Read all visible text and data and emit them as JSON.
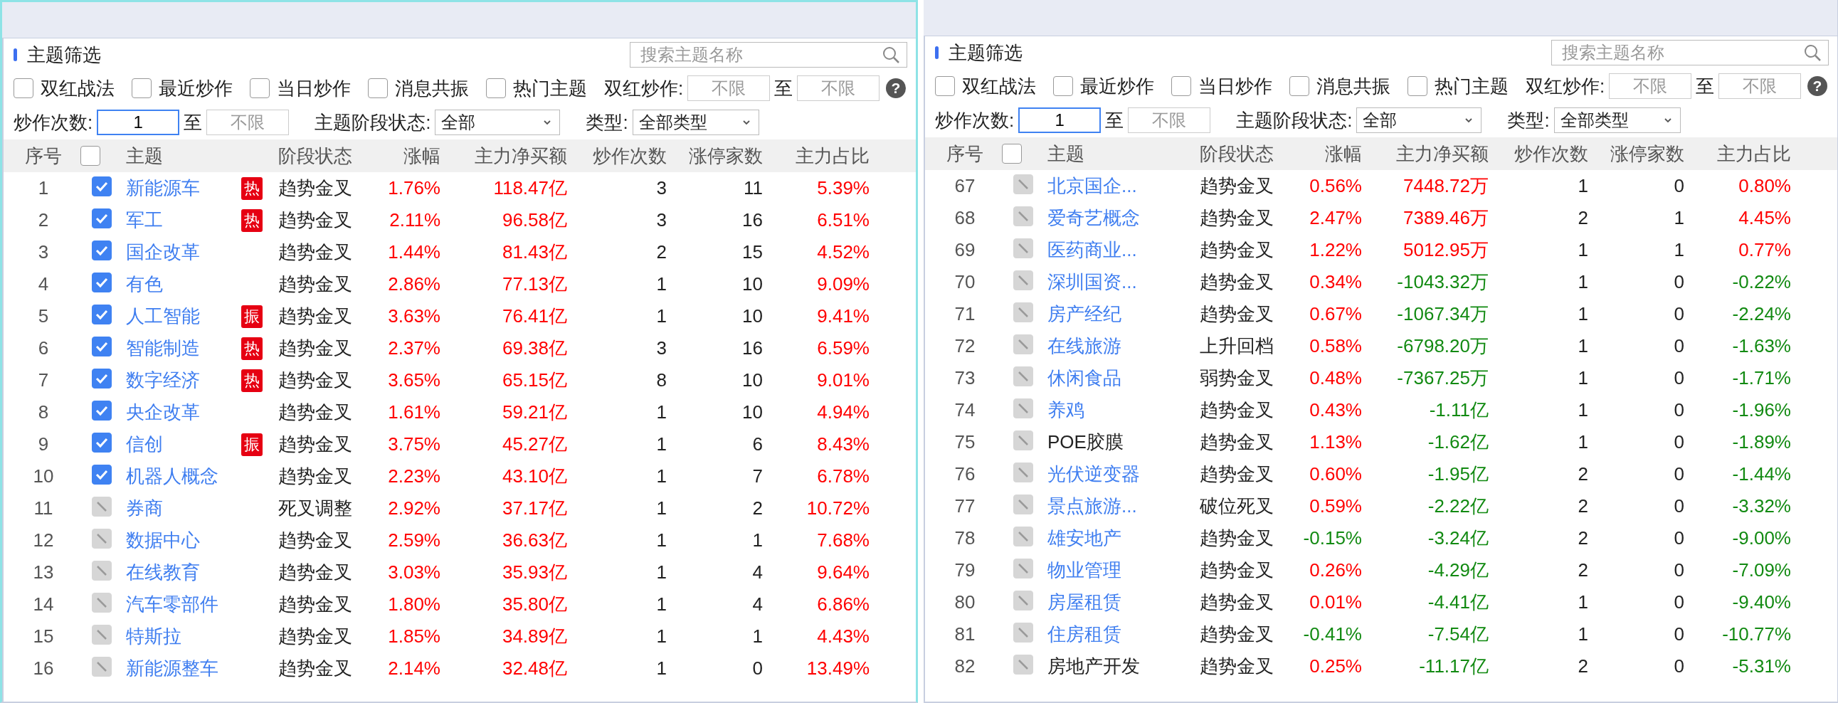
{
  "panels": [
    {
      "active": true,
      "title": "主题筛选",
      "search": {
        "placeholder": "搜索主题名称"
      },
      "filters": [
        {
          "label": "双红战法",
          "checked": false
        },
        {
          "label": "最近炒作",
          "checked": false
        },
        {
          "label": "当日炒作",
          "checked": false
        },
        {
          "label": "消息共振",
          "checked": false
        },
        {
          "label": "热门主题",
          "checked": false
        }
      ],
      "double_red": {
        "label": "双红炒作:",
        "from": {
          "placeholder": "不限"
        },
        "to_label": "至",
        "to": {
          "placeholder": "不限"
        }
      },
      "help_icon": "?",
      "hype_count": {
        "label": "炒作次数:",
        "from": {
          "value": "1",
          "focused": true
        },
        "to_label": "至",
        "to": {
          "placeholder": "不限"
        }
      },
      "stage": {
        "label": "主题阶段状态:",
        "value": "全部"
      },
      "type": {
        "label": "类型:",
        "value": "全部类型"
      },
      "columns": [
        "序号",
        "主题",
        "阶段状态",
        "涨幅",
        "主力净买额",
        "炒作次数",
        "涨停家数",
        "主力占比"
      ],
      "header_checked": false,
      "rows": [
        {
          "index": "1",
          "checked": true,
          "theme": "新能源车",
          "link": true,
          "badge": "热",
          "stage": "趋势金叉",
          "change": "1.76%",
          "net": "118.47亿",
          "count": "3",
          "limit_up": "11",
          "ratio": "5.39%",
          "up": [
            true,
            true,
            true
          ]
        },
        {
          "index": "2",
          "checked": true,
          "theme": "军工",
          "link": true,
          "badge": "热",
          "stage": "趋势金叉",
          "change": "2.11%",
          "net": "96.58亿",
          "count": "3",
          "limit_up": "16",
          "ratio": "6.51%",
          "up": [
            true,
            true,
            true
          ]
        },
        {
          "index": "3",
          "checked": true,
          "theme": "国企改革",
          "link": true,
          "stage": "趋势金叉",
          "change": "1.44%",
          "net": "81.43亿",
          "count": "2",
          "limit_up": "15",
          "ratio": "4.52%",
          "up": [
            true,
            true,
            true
          ]
        },
        {
          "index": "4",
          "checked": true,
          "theme": "有色",
          "link": true,
          "stage": "趋势金叉",
          "change": "2.86%",
          "net": "77.13亿",
          "count": "1",
          "limit_up": "10",
          "ratio": "9.09%",
          "up": [
            true,
            true,
            true
          ]
        },
        {
          "index": "5",
          "checked": true,
          "theme": "人工智能",
          "link": true,
          "badge": "振",
          "stage": "趋势金叉",
          "change": "3.63%",
          "net": "76.41亿",
          "count": "1",
          "limit_up": "10",
          "ratio": "9.41%",
          "up": [
            true,
            true,
            true
          ]
        },
        {
          "index": "6",
          "checked": true,
          "theme": "智能制造",
          "link": true,
          "badge": "热",
          "stage": "趋势金叉",
          "change": "2.37%",
          "net": "69.38亿",
          "count": "3",
          "limit_up": "16",
          "ratio": "6.59%",
          "up": [
            true,
            true,
            true
          ]
        },
        {
          "index": "7",
          "checked": true,
          "theme": "数字经济",
          "link": true,
          "badge": "热",
          "stage": "趋势金叉",
          "change": "3.65%",
          "net": "65.15亿",
          "count": "8",
          "limit_up": "10",
          "ratio": "9.01%",
          "up": [
            true,
            true,
            true
          ]
        },
        {
          "index": "8",
          "checked": true,
          "theme": "央企改革",
          "link": true,
          "stage": "趋势金叉",
          "change": "1.61%",
          "net": "59.21亿",
          "count": "1",
          "limit_up": "10",
          "ratio": "4.94%",
          "up": [
            true,
            true,
            true
          ]
        },
        {
          "index": "9",
          "checked": true,
          "theme": "信创",
          "link": true,
          "badge": "振",
          "stage": "趋势金叉",
          "change": "3.75%",
          "net": "45.27亿",
          "count": "1",
          "limit_up": "6",
          "ratio": "8.43%",
          "up": [
            true,
            true,
            true
          ]
        },
        {
          "index": "10",
          "checked": true,
          "theme": "机器人概念",
          "link": true,
          "stage": "趋势金叉",
          "change": "2.23%",
          "net": "43.10亿",
          "count": "1",
          "limit_up": "7",
          "ratio": "6.78%",
          "up": [
            true,
            true,
            true
          ]
        },
        {
          "index": "11",
          "checked": false,
          "theme": "券商",
          "link": true,
          "stage": "死叉调整",
          "change": "2.92%",
          "net": "37.17亿",
          "count": "1",
          "limit_up": "2",
          "ratio": "10.72%",
          "up": [
            true,
            true,
            true
          ]
        },
        {
          "index": "12",
          "checked": false,
          "theme": "数据中心",
          "link": true,
          "stage": "趋势金叉",
          "change": "2.59%",
          "net": "36.63亿",
          "count": "1",
          "limit_up": "1",
          "ratio": "7.68%",
          "up": [
            true,
            true,
            true
          ]
        },
        {
          "index": "13",
          "checked": false,
          "theme": "在线教育",
          "link": true,
          "stage": "趋势金叉",
          "change": "3.03%",
          "net": "35.93亿",
          "count": "1",
          "limit_up": "4",
          "ratio": "9.64%",
          "up": [
            true,
            true,
            true
          ]
        },
        {
          "index": "14",
          "checked": false,
          "theme": "汽车零部件",
          "link": true,
          "stage": "趋势金叉",
          "change": "1.80%",
          "net": "35.80亿",
          "count": "1",
          "limit_up": "4",
          "ratio": "6.86%",
          "up": [
            true,
            true,
            true
          ]
        },
        {
          "index": "15",
          "checked": false,
          "theme": "特斯拉",
          "link": true,
          "stage": "趋势金叉",
          "change": "1.85%",
          "net": "34.89亿",
          "count": "1",
          "limit_up": "1",
          "ratio": "4.43%",
          "up": [
            true,
            true,
            true
          ]
        },
        {
          "index": "16",
          "checked": false,
          "theme": "新能源整车",
          "link": true,
          "stage": "趋势金叉",
          "change": "2.14%",
          "net": "32.48亿",
          "count": "1",
          "limit_up": "0",
          "ratio": "13.49%",
          "up": [
            true,
            true,
            true
          ]
        }
      ]
    },
    {
      "active": false,
      "title": "主题筛选",
      "search": {
        "placeholder": "搜索主题名称"
      },
      "filters": [
        {
          "label": "双红战法",
          "checked": false
        },
        {
          "label": "最近炒作",
          "checked": false
        },
        {
          "label": "当日炒作",
          "checked": false
        },
        {
          "label": "消息共振",
          "checked": false
        },
        {
          "label": "热门主题",
          "checked": false
        }
      ],
      "double_red": {
        "label": "双红炒作:",
        "from": {
          "placeholder": "不限"
        },
        "to_label": "至",
        "to": {
          "placeholder": "不限"
        }
      },
      "help_icon": "?",
      "hype_count": {
        "label": "炒作次数:",
        "from": {
          "value": "1",
          "focused": true
        },
        "to_label": "至",
        "to": {
          "placeholder": "不限"
        }
      },
      "stage": {
        "label": "主题阶段状态:",
        "value": "全部"
      },
      "type": {
        "label": "类型:",
        "value": "全部类型"
      },
      "columns": [
        "序号",
        "主题",
        "阶段状态",
        "涨幅",
        "主力净买额",
        "炒作次数",
        "涨停家数",
        "主力占比"
      ],
      "header_checked": false,
      "rows": [
        {
          "index": "67",
          "checked": false,
          "theme": "北京国企...",
          "link": true,
          "stage": "趋势金叉",
          "change": "0.56%",
          "net": "7448.72万",
          "count": "1",
          "limit_up": "0",
          "ratio": "0.80%",
          "up": [
            true,
            true,
            true
          ]
        },
        {
          "index": "68",
          "checked": false,
          "theme": "爱奇艺概念",
          "link": true,
          "stage": "趋势金叉",
          "change": "2.47%",
          "net": "7389.46万",
          "count": "2",
          "limit_up": "1",
          "ratio": "4.45%",
          "up": [
            true,
            true,
            true
          ]
        },
        {
          "index": "69",
          "checked": false,
          "theme": "医药商业...",
          "link": true,
          "stage": "趋势金叉",
          "change": "1.22%",
          "net": "5012.95万",
          "count": "1",
          "limit_up": "1",
          "ratio": "0.77%",
          "up": [
            true,
            true,
            true
          ]
        },
        {
          "index": "70",
          "checked": false,
          "theme": "深圳国资...",
          "link": true,
          "stage": "趋势金叉",
          "change": "0.34%",
          "net": "-1043.32万",
          "count": "1",
          "limit_up": "0",
          "ratio": "-0.22%",
          "up": [
            true,
            false,
            false
          ]
        },
        {
          "index": "71",
          "checked": false,
          "theme": "房产经纪",
          "link": true,
          "stage": "趋势金叉",
          "change": "0.67%",
          "net": "-1067.34万",
          "count": "1",
          "limit_up": "0",
          "ratio": "-2.24%",
          "up": [
            true,
            false,
            false
          ]
        },
        {
          "index": "72",
          "checked": false,
          "theme": "在线旅游",
          "link": true,
          "stage": "上升回档",
          "change": "0.58%",
          "net": "-6798.20万",
          "count": "1",
          "limit_up": "0",
          "ratio": "-1.63%",
          "up": [
            true,
            false,
            false
          ]
        },
        {
          "index": "73",
          "checked": false,
          "theme": "休闲食品",
          "link": true,
          "stage": "弱势金叉",
          "change": "0.48%",
          "net": "-7367.25万",
          "count": "1",
          "limit_up": "0",
          "ratio": "-1.71%",
          "up": [
            true,
            false,
            false
          ]
        },
        {
          "index": "74",
          "checked": false,
          "theme": "养鸡",
          "link": true,
          "stage": "趋势金叉",
          "change": "0.43%",
          "net": "-1.11亿",
          "count": "1",
          "limit_up": "0",
          "ratio": "-1.96%",
          "up": [
            true,
            false,
            false
          ]
        },
        {
          "index": "75",
          "checked": false,
          "theme": "POE胶膜",
          "link": false,
          "stage": "趋势金叉",
          "change": "1.13%",
          "net": "-1.62亿",
          "count": "1",
          "limit_up": "0",
          "ratio": "-1.89%",
          "up": [
            true,
            false,
            false
          ]
        },
        {
          "index": "76",
          "checked": false,
          "theme": "光伏逆变器",
          "link": true,
          "stage": "趋势金叉",
          "change": "0.60%",
          "net": "-1.95亿",
          "count": "2",
          "limit_up": "0",
          "ratio": "-1.44%",
          "up": [
            true,
            false,
            false
          ]
        },
        {
          "index": "77",
          "checked": false,
          "theme": "景点旅游...",
          "link": true,
          "stage": "破位死叉",
          "change": "0.59%",
          "net": "-2.22亿",
          "count": "2",
          "limit_up": "0",
          "ratio": "-3.32%",
          "up": [
            true,
            false,
            false
          ]
        },
        {
          "index": "78",
          "checked": false,
          "theme": "雄安地产",
          "link": true,
          "stage": "趋势金叉",
          "change": "-0.15%",
          "net": "-3.24亿",
          "count": "2",
          "limit_up": "0",
          "ratio": "-9.00%",
          "up": [
            false,
            false,
            false
          ]
        },
        {
          "index": "79",
          "checked": false,
          "theme": "物业管理",
          "link": true,
          "stage": "趋势金叉",
          "change": "0.26%",
          "net": "-4.29亿",
          "count": "2",
          "limit_up": "0",
          "ratio": "-7.09%",
          "up": [
            true,
            false,
            false
          ]
        },
        {
          "index": "80",
          "checked": false,
          "theme": "房屋租赁",
          "link": true,
          "stage": "趋势金叉",
          "change": "0.01%",
          "net": "-4.41亿",
          "count": "1",
          "limit_up": "0",
          "ratio": "-9.40%",
          "up": [
            true,
            false,
            false
          ]
        },
        {
          "index": "81",
          "checked": false,
          "theme": "住房租赁",
          "link": true,
          "stage": "趋势金叉",
          "change": "-0.41%",
          "net": "-7.54亿",
          "count": "1",
          "limit_up": "0",
          "ratio": "-10.77%",
          "up": [
            false,
            false,
            false
          ]
        },
        {
          "index": "82",
          "checked": false,
          "theme": "房地产开发",
          "link": false,
          "stage": "趋势金叉",
          "change": "0.25%",
          "net": "-11.17亿",
          "count": "2",
          "limit_up": "0",
          "ratio": "-5.31%",
          "up": [
            true,
            false,
            false
          ]
        }
      ]
    }
  ]
}
